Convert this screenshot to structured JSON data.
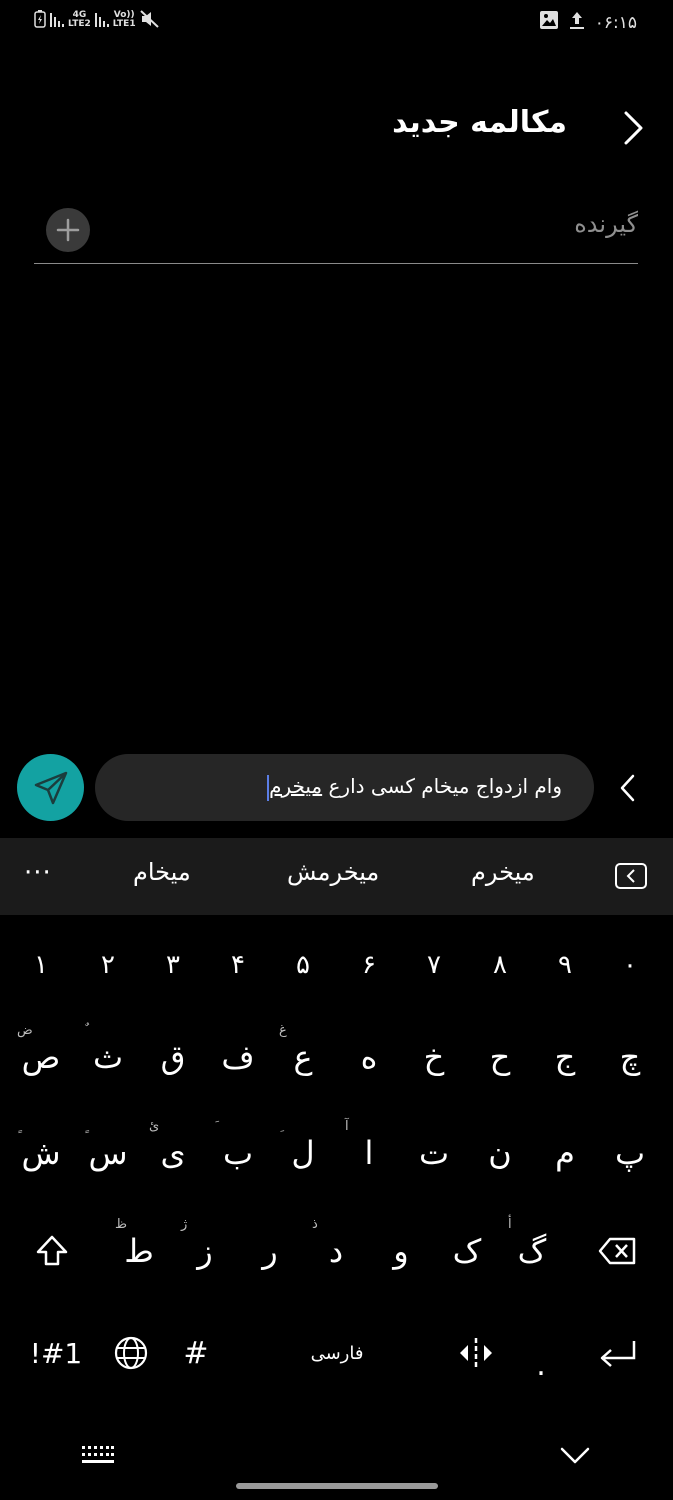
{
  "status_bar": {
    "time": "۰۶:۱۵",
    "net1_top": "4G",
    "net1_bottom": "LTE2",
    "net2_top": "Vo))",
    "net2_bottom": "LTE1"
  },
  "header": {
    "title": "مکالمه جدید"
  },
  "recipient": {
    "placeholder": "گیرنده"
  },
  "compose": {
    "text_before": "وام ازدواج میخام کسی دارع ",
    "composing_word": "میخرم"
  },
  "suggestions": {
    "more": "···",
    "words": [
      "میخام",
      "میخرمش",
      "میخرم"
    ]
  },
  "keyboard": {
    "numbers": [
      "۱",
      "۲",
      "۳",
      "۴",
      "۵",
      "۶",
      "۷",
      "۸",
      "۹",
      "۰"
    ],
    "row1": [
      "ص",
      "ث",
      "ق",
      "ف",
      "ع",
      "ه",
      "خ",
      "ح",
      "ج",
      "چ"
    ],
    "row1_hints": [
      "ض",
      "ٌ",
      "",
      "",
      "غ",
      "",
      "",
      "",
      "",
      ""
    ],
    "row2": [
      "ش",
      "س",
      "ی",
      "ب",
      "ل",
      "ا",
      "ت",
      "ن",
      "م",
      "پ"
    ],
    "row2_hints": [
      "ٍ",
      "ٍ",
      "ئ",
      "َ",
      "ِ",
      "آ",
      "",
      "",
      "",
      ""
    ],
    "row3": [
      "ط",
      "ز",
      "ر",
      "د",
      "و",
      "ک",
      "گ"
    ],
    "row3_hints": [
      "ظ",
      "ژ",
      "",
      "ذ",
      "",
      "",
      "ﺃ"
    ],
    "symbols_label": "!#1",
    "hash_label": "#",
    "space_label": "فارسی",
    "period_label": "."
  }
}
